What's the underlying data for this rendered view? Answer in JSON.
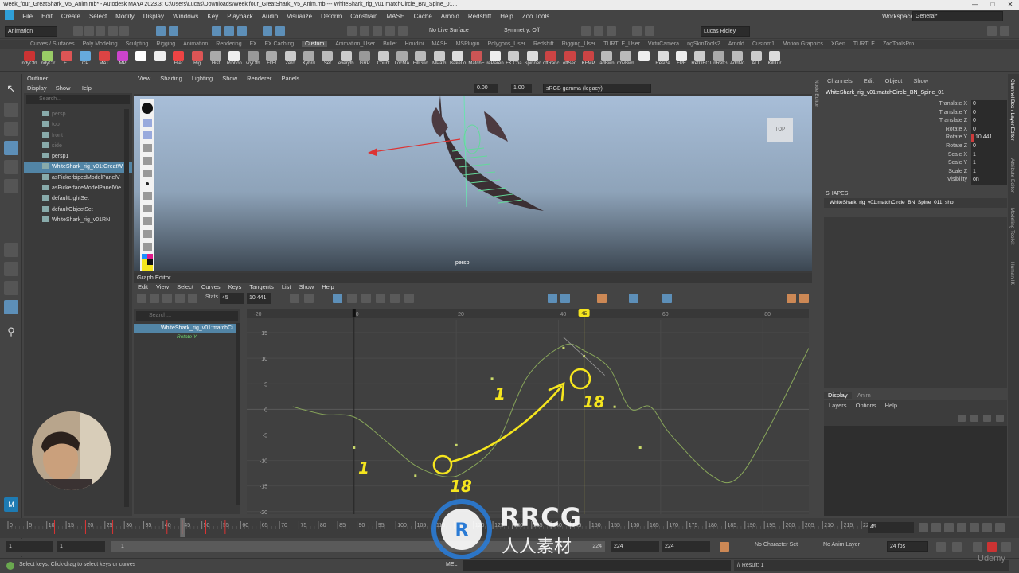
{
  "window": {
    "title": "Week_four_GreatShark_V5_Anim.mb* - Autodesk MAYA 2023.3: C:\\Users\\Lucas\\Downloads\\Week four_GreatShark_V5_Anim.mb   ---   WhiteShark_rig_v01:matchCircle_BN_Spine_01...",
    "minimize": "—",
    "maximize": "□",
    "close": "✕"
  },
  "menubar": {
    "items": [
      "File",
      "Edit",
      "Create",
      "Select",
      "Modify",
      "Display",
      "Windows",
      "Key",
      "Playback",
      "Audio",
      "Visualize",
      "Deform",
      "Constrain",
      "MASH",
      "Cache",
      "Arnold",
      "Redshift",
      "Help",
      "Zoo Tools"
    ],
    "workspace_label": "Workspace:",
    "workspace_value": "General*"
  },
  "statusline": {
    "mode": "Animation",
    "live_surface": "No Live Surface",
    "symmetry": "Symmetry: Off",
    "user": "Lucas Ridley"
  },
  "shelf": {
    "tabs": [
      "Curves / Surfaces",
      "Poly Modeling",
      "Sculpting",
      "Rigging",
      "Animation",
      "Rendering",
      "FX",
      "FX Caching",
      "Custom",
      "Animation_User",
      "Bullet",
      "Houdini",
      "MASH",
      "MSPlugin",
      "Polygons_User",
      "Redshift",
      "Rigging_User",
      "TURTLE_User",
      "VirtuCamera",
      "ngSkinTools2",
      "Arnold",
      "Custom1",
      "Motion Graphics",
      "XGen",
      "TURTLE",
      "ZooToolsPro"
    ],
    "active_tab": "Custom",
    "items": [
      "ndyCtrl",
      "ndyCtr",
      "FT",
      "CP",
      "MAT",
      "MP",
      "",
      "",
      "Hier",
      "Rig",
      "Hist",
      "Ribbon",
      "vryOth",
      "FltFt",
      "Zero",
      "Kybrd",
      "Set",
      "everyth",
      "GRP",
      "Count",
      "LocMA",
      "FillGrid",
      "MPath",
      "BakeLo",
      "MatchE",
      "reParen",
      "FK Cha",
      "Spinner",
      "offRanc",
      "offSeq",
      "KFMP",
      "adBwn",
      "rmvBwn",
      "",
      "Resize",
      "FPE",
      "RefGEC",
      "UnRefG",
      "AddNo",
      "ALL",
      "KillTur"
    ]
  },
  "outliner": {
    "title": "Outliner",
    "menu": [
      "Display",
      "Show",
      "Help"
    ],
    "search_placeholder": "Search...",
    "items": [
      {
        "label": "persp",
        "dim": true
      },
      {
        "label": "top",
        "dim": true
      },
      {
        "label": "front",
        "dim": true
      },
      {
        "label": "side",
        "dim": true
      },
      {
        "label": "persp1",
        "dim": false
      },
      {
        "label": "WhiteShark_rig_v01:GreatW",
        "dim": false,
        "selected": true
      },
      {
        "label": "asPickerbipedModelPanelV",
        "dim": false
      },
      {
        "label": "asPickerfaceModelPanelVie",
        "dim": false
      },
      {
        "label": "defaultLightSet",
        "dim": false
      },
      {
        "label": "defaultObjectSet",
        "dim": false
      },
      {
        "label": "WhiteShark_rig_v01RN",
        "dim": false
      }
    ]
  },
  "viewport": {
    "menu": [
      "View",
      "Shading",
      "Lighting",
      "Show",
      "Renderer",
      "Panels"
    ],
    "field_a": "0.00",
    "field_b": "1.00",
    "color_space": "sRGB gamma (legacy)",
    "camera_label": "persp",
    "viewcube_label": "TOP"
  },
  "graph_editor": {
    "title": "Graph Editor",
    "menu": [
      "Edit",
      "View",
      "Select",
      "Curves",
      "Keys",
      "Tangents",
      "List",
      "Show",
      "Help"
    ],
    "stats_label": "Stats",
    "stats_frame": "45",
    "stats_value": "10.441",
    "search_placeholder": "Search...",
    "outline_node": "WhiteShark_rig_v01:matchCi",
    "outline_attr": "Rotate Y",
    "x_ticks": [
      {
        "v": -20,
        "label": "-20"
      },
      {
        "v": 0,
        "label": "0"
      },
      {
        "v": 20,
        "label": "20"
      },
      {
        "v": 40,
        "label": "40"
      },
      {
        "v": 60,
        "label": "60"
      },
      {
        "v": 80,
        "label": "80"
      }
    ],
    "y_ticks": [
      {
        "v": 15,
        "label": "15"
      },
      {
        "v": 10,
        "label": "10"
      },
      {
        "v": 5,
        "label": "5"
      },
      {
        "v": 0,
        "label": "0"
      },
      {
        "v": -5,
        "label": "-5"
      },
      {
        "v": -10,
        "label": "-10"
      },
      {
        "v": -15,
        "label": "-15"
      },
      {
        "v": -20,
        "label": "-20"
      }
    ],
    "current_frame": "45",
    "annotations": [
      "1",
      "1",
      "18",
      "18"
    ]
  },
  "chart_data": {
    "type": "line",
    "title": "",
    "xlabel": "",
    "ylabel": "",
    "xlim": [
      -21,
      89
    ],
    "ylim": [
      -20.5,
      17.5
    ],
    "series": [
      {
        "x": [
          -12,
          -6,
          0,
          6,
          12,
          18,
          22,
          28,
          34,
          41,
          45,
          50,
          54,
          58,
          62,
          70,
          75,
          81,
          89
        ],
        "y": [
          0.5,
          -1,
          -1.5,
          -6,
          -11,
          -13.2,
          -12,
          -6.5,
          6.5,
          12.5,
          11.5,
          8,
          0.2,
          0.5,
          -5,
          -13,
          -13.5,
          -4,
          12
        ]
      }
    ],
    "keys": [
      {
        "x": 0,
        "y": -7.5
      },
      {
        "x": 12,
        "y": -13
      },
      {
        "x": 20,
        "y": -7
      },
      {
        "x": 27,
        "y": 6
      },
      {
        "x": 41,
        "y": 12
      },
      {
        "x": 45,
        "y": 10.4
      },
      {
        "x": 51,
        "y": 0.5
      },
      {
        "x": 56,
        "y": -7.5
      }
    ]
  },
  "channel_box": {
    "menu": [
      "Channels",
      "Edit",
      "Object",
      "Show"
    ],
    "node": "WhiteShark_rig_v01:matchCircle_BN_Spine_01",
    "channels": [
      {
        "name": "Translate X",
        "value": "0"
      },
      {
        "name": "Translate Y",
        "value": "0"
      },
      {
        "name": "Translate Z",
        "value": "0"
      },
      {
        "name": "Rotate X",
        "value": "0"
      },
      {
        "name": "Rotate Y",
        "value": "10.441",
        "keyed": true
      },
      {
        "name": "Rotate Z",
        "value": "0"
      },
      {
        "name": "Scale X",
        "value": "1"
      },
      {
        "name": "Scale Y",
        "value": "1"
      },
      {
        "name": "Scale Z",
        "value": "1"
      },
      {
        "name": "Visibility",
        "value": "on"
      }
    ],
    "shapes_label": "SHAPES",
    "shape_node": "WhiteShark_rig_v01:matchCircle_BN_Spine_011_shp"
  },
  "layer_editor": {
    "tabs": [
      "Display",
      "Anim"
    ],
    "menu": [
      "Layers",
      "Options",
      "Help"
    ]
  },
  "side_tabs": [
    "Channel Box / Layer Editor",
    "Attribute Editor",
    "Modeling Toolkit",
    "Human IK"
  ],
  "node_editor_tab": "Node Editor",
  "time_slider": {
    "ticks": [
      "0",
      "5",
      "10",
      "15",
      "20",
      "25",
      "30",
      "35",
      "40",
      "45",
      "50",
      "55",
      "60",
      "65",
      "70",
      "75",
      "80",
      "85",
      "90",
      "95",
      "100",
      "105",
      "110",
      "115",
      "120",
      "125",
      "130",
      "135",
      "140",
      "145",
      "150",
      "155",
      "160",
      "165",
      "170",
      "175",
      "180",
      "185",
      "190",
      "195",
      "200",
      "205",
      "210",
      "215",
      "220"
    ],
    "current_frame": "45"
  },
  "range_slider": {
    "start": "1",
    "start_inner": "1",
    "range_start": "1",
    "range_end": "224",
    "end_inner": "224",
    "end": "224",
    "character_set": "No Character Set",
    "anim_layer": "No Anim Layer",
    "fps": "24 fps"
  },
  "help_line": {
    "text": "Select keys: Click-drag to select keys or curves",
    "mel_label": "MEL",
    "result": "// Result: 1"
  },
  "watermark": {
    "brand": "RRCG",
    "sub": "人人素材",
    "udemy": "Udemy"
  },
  "colors": {
    "accent": "#5d8fb8",
    "curve": "#88a65a",
    "annotation": "#f5e51e",
    "current_time": "#e6d84a"
  }
}
